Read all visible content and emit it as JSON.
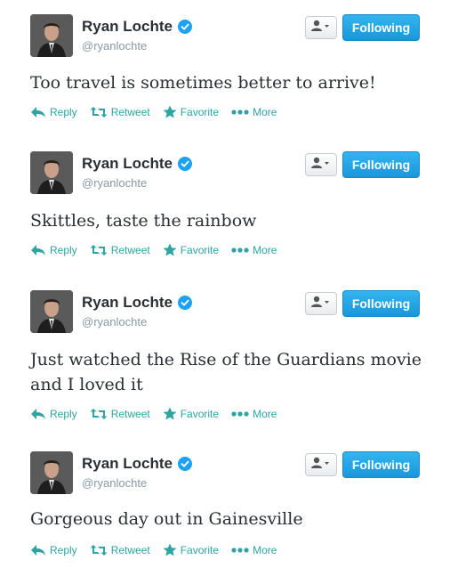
{
  "tweets": [
    {
      "name": "Ryan Lochte",
      "handle": "@ryanlochte",
      "follow_label": "Following",
      "text": "Too travel is sometimes better to arrive!",
      "actions": {
        "reply": "Reply",
        "retweet": "Retweet",
        "favorite": "Favorite",
        "more": "More"
      }
    },
    {
      "name": "Ryan Lochte",
      "handle": "@ryanlochte",
      "follow_label": "Following",
      "text": "Skittles, taste the rainbow",
      "actions": {
        "reply": "Reply",
        "retweet": "Retweet",
        "favorite": "Favorite",
        "more": "More"
      }
    },
    {
      "name": "Ryan Lochte",
      "handle": "@ryanlochte",
      "follow_label": "Following",
      "text": "Just watched the Rise of the Guardians movie and I loved it",
      "actions": {
        "reply": "Reply",
        "retweet": "Retweet",
        "favorite": "Favorite",
        "more": "More"
      }
    },
    {
      "name": "Ryan Lochte",
      "handle": "@ryanlochte",
      "follow_label": "Following",
      "text": "Gorgeous day out in Gainesville",
      "actions": {
        "reply": "Reply",
        "retweet": "Retweet",
        "favorite": "Favorite",
        "more": "More"
      }
    }
  ],
  "icons": {
    "verified": "verified-badge-icon",
    "user": "user-dropdown-icon",
    "reply": "reply-arrow-icon",
    "retweet": "retweet-icon",
    "favorite": "star-icon",
    "more": "dots-icon"
  },
  "colors": {
    "accent": "#1da1f2",
    "action": "#2fa3a3",
    "follow": "#1a97db"
  }
}
